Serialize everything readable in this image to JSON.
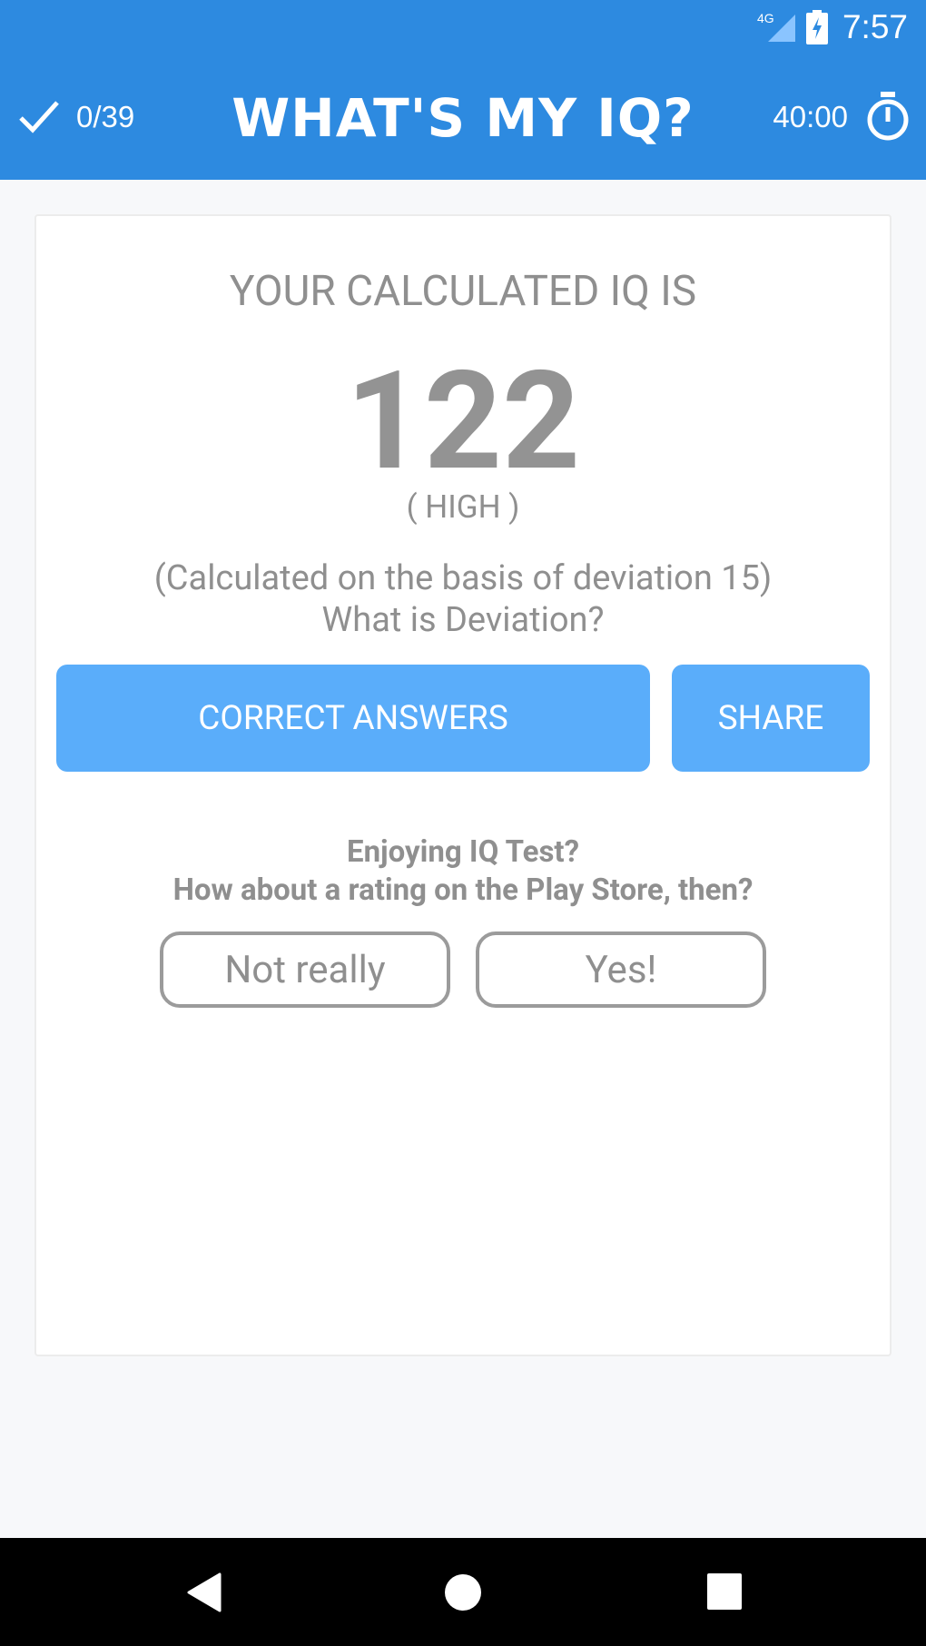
{
  "status_bar": {
    "network": "4G",
    "time": "7:57",
    "icons": [
      "signal-icon",
      "battery-charging-icon"
    ]
  },
  "app_bar": {
    "progress": "0/39",
    "title": "WHAT'S MY IQ?",
    "timer": "40:00",
    "accent_color": "#2d8ae0"
  },
  "result": {
    "heading": "YOUR CALCULATED IQ IS",
    "score": "122",
    "level": "( HIGH )",
    "basis": "(Calculated on the basis of deviation 15)",
    "deviation_link": "What is Deviation?"
  },
  "actions": {
    "correct_answers": "CORRECT ANSWERS",
    "share": "SHARE",
    "button_color": "#5aadfa"
  },
  "rating": {
    "question": "Enjoying IQ Test?",
    "prompt": "How about a rating on the Play Store, then?",
    "no_label": "Not really",
    "yes_label": "Yes!"
  },
  "nav": {
    "icons": [
      "back-icon",
      "home-icon",
      "recents-icon"
    ]
  }
}
